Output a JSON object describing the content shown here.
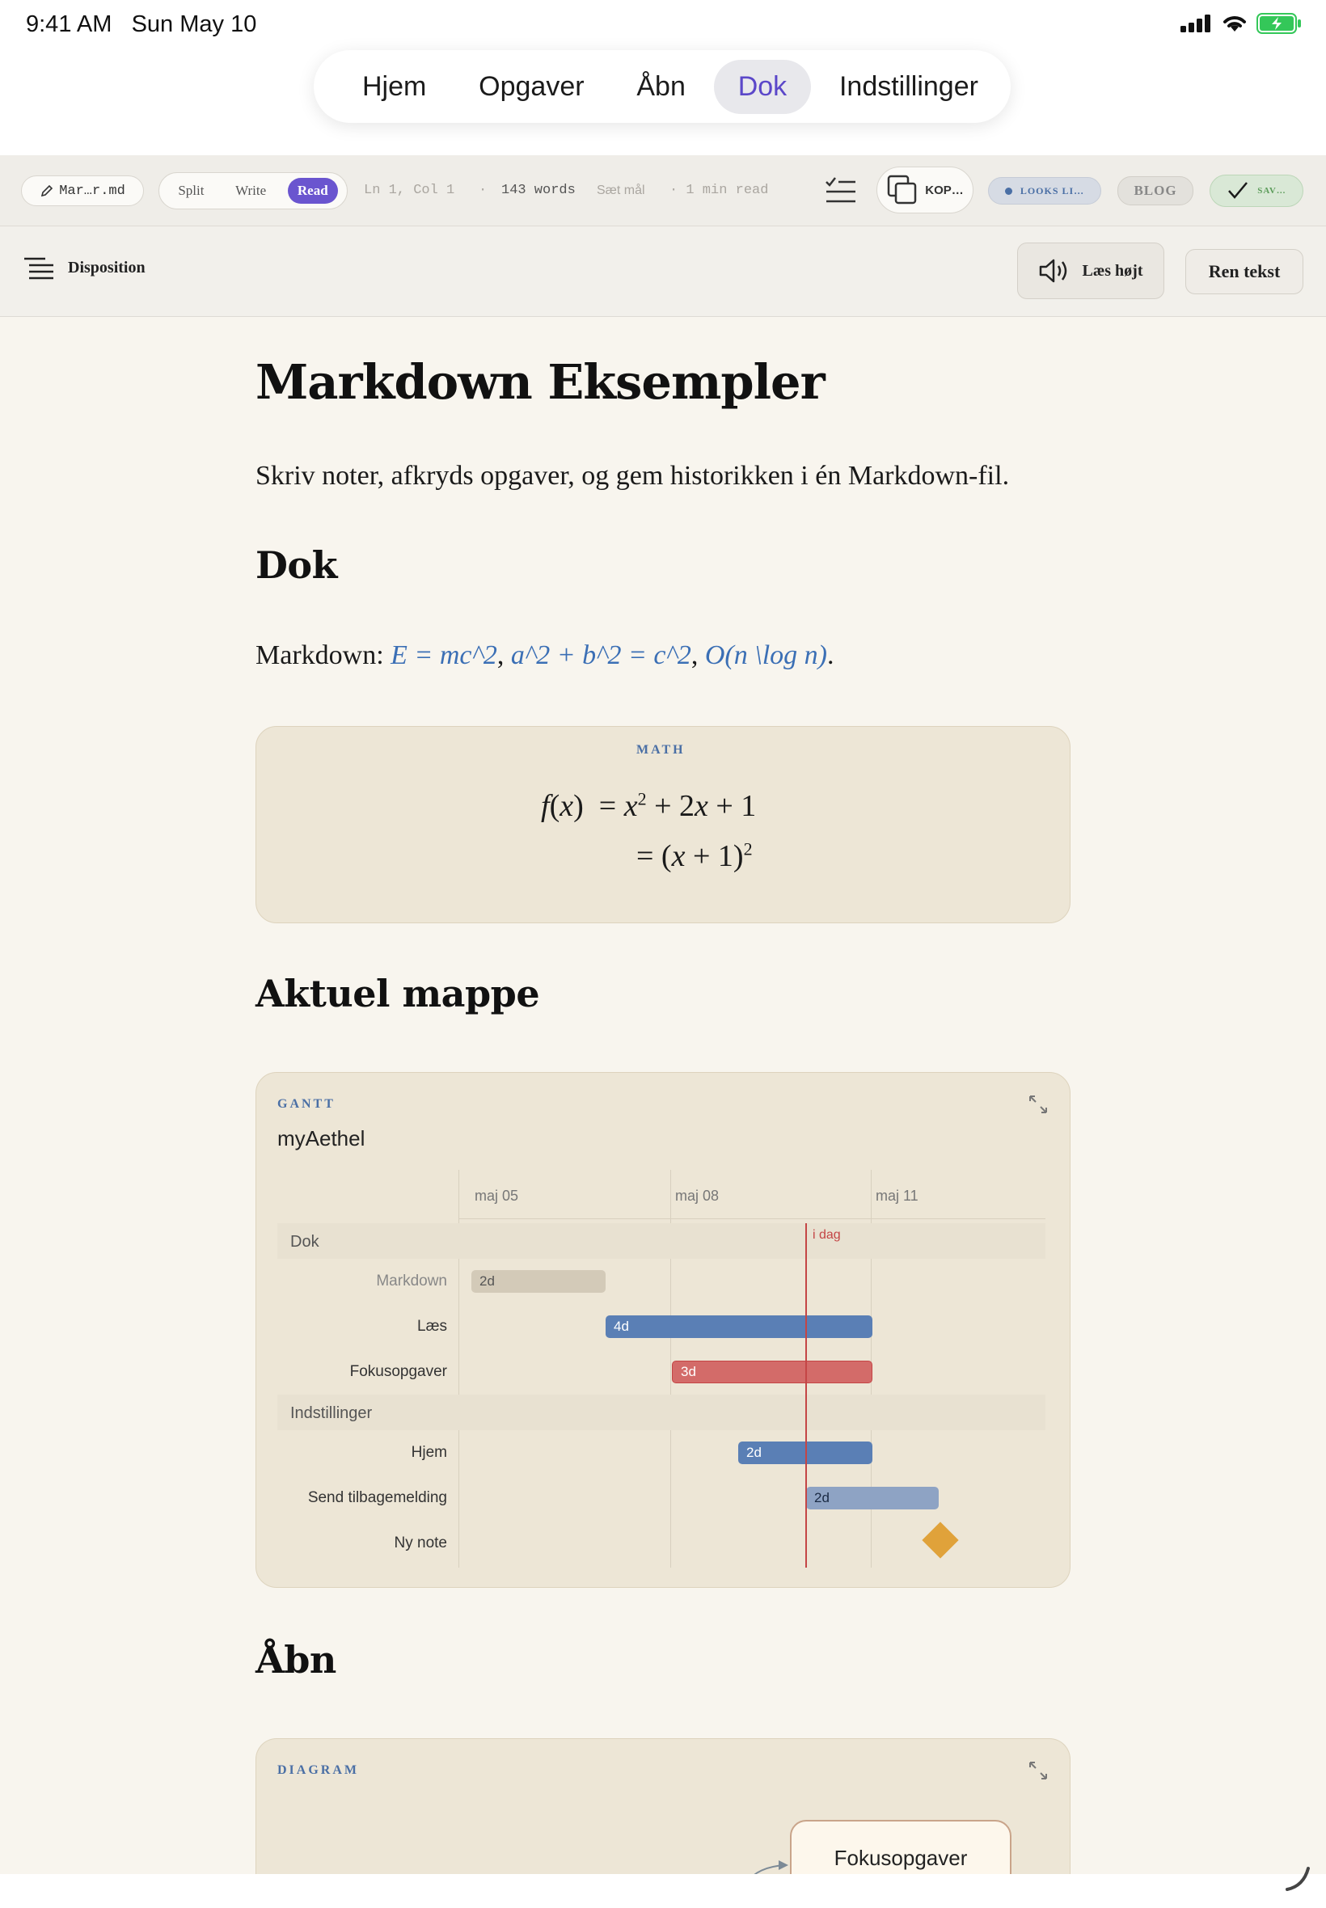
{
  "status": {
    "time": "9:41 AM",
    "date": "Sun May 10"
  },
  "tabs": [
    {
      "label": "Hjem"
    },
    {
      "label": "Opgaver"
    },
    {
      "label": "Åbn"
    },
    {
      "label": "Dok",
      "active": true
    },
    {
      "label": "Indstillinger"
    }
  ],
  "toolbar": {
    "file_name": "Mar…r.md",
    "modes": [
      "Split",
      "Write",
      "Read"
    ],
    "active_mode": "Read",
    "cursor": "Ln 1, Col 1",
    "separator": "·",
    "words": "143 words",
    "goal": "Sæt mål",
    "read_time": "· 1 min read",
    "copy_label": "KOP…",
    "looks_label": "LOOKS LI…",
    "blog_label": "BLOG",
    "saved_label": "SAV…"
  },
  "subbar": {
    "outline_label": "Disposition",
    "read_aloud_label": "Læs højt",
    "plain_text_label": "Ren tekst"
  },
  "doc": {
    "title": "Markdown Eksempler",
    "intro": "Skriv noter, afkryds opgaver, og gem historikken i én Markdown-fil.",
    "h_dok": "Dok",
    "math_prefix": "Markdown: ",
    "math_inline": [
      "E = mc^2",
      "a^2 + b^2 = c^2",
      "O(n \\log n)"
    ],
    "math_card_label": "MATH",
    "h_folder": "Aktuel mappe",
    "h_open": "Åbn",
    "diagram_label": "DIAGRAM",
    "diagram_node": "Fokusopgaver"
  },
  "gantt": {
    "label": "GANTT",
    "title": "myAethel",
    "axis": [
      "maj 05",
      "maj 08",
      "maj 11"
    ],
    "today_label": "i dag",
    "sections": [
      {
        "name": "Dok",
        "tasks": [
          {
            "name": "Markdown",
            "duration": "2d",
            "state": "done"
          },
          {
            "name": "Læs",
            "duration": "4d",
            "state": "active"
          },
          {
            "name": "Fokusopgaver",
            "duration": "3d",
            "state": "critical"
          }
        ]
      },
      {
        "name": "Indstillinger",
        "tasks": [
          {
            "name": "Hjem",
            "duration": "2d",
            "state": "active"
          },
          {
            "name": "Send tilbagemelding",
            "duration": "2d",
            "state": "pending"
          },
          {
            "name": "Ny note",
            "duration": "",
            "state": "milestone"
          }
        ]
      }
    ],
    "colors": {
      "done": "#d3cab8",
      "active": "#5a7fb5",
      "critical": "#d36b69",
      "pending": "#8ea3c4",
      "milestone": "#e0a23a",
      "today": "#c44545"
    }
  }
}
